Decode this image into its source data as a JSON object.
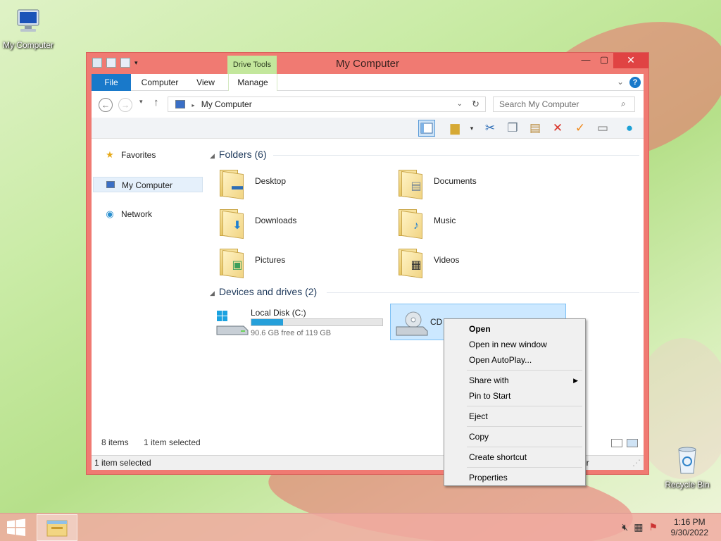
{
  "desktop": {
    "icons": [
      {
        "label": "My Computer",
        "icon": "computer-icon"
      },
      {
        "label": "Recycle Bin",
        "icon": "recycle-bin-icon"
      }
    ]
  },
  "window": {
    "title": "My Computer",
    "context_tab_group": "Drive Tools",
    "ribbon_tabs": [
      "File",
      "Computer",
      "View",
      "Manage"
    ],
    "address": "My Computer",
    "search_placeholder": "Search My Computer",
    "nav": [
      "Favorites",
      "My Computer",
      "Network"
    ],
    "folders_group": "Folders (6)",
    "folders": [
      {
        "name": "Desktop",
        "emblem": "desktop-icon"
      },
      {
        "name": "Documents",
        "emblem": "document-icon"
      },
      {
        "name": "Downloads",
        "emblem": "download-arrow-icon"
      },
      {
        "name": "Music",
        "emblem": "music-note-icon"
      },
      {
        "name": "Pictures",
        "emblem": "picture-icon"
      },
      {
        "name": "Videos",
        "emblem": "film-icon"
      }
    ],
    "devices_group": "Devices and drives (2)",
    "drives": [
      {
        "name": "Local Disk (C:)",
        "free": "90.6 GB free of 119 GB",
        "used_fraction": 0.24
      },
      {
        "name": "CD Drive (D:)"
      }
    ],
    "item_count": "8 items",
    "selection": "1 item selected",
    "status": "1 item selected",
    "status_tail": "er"
  },
  "context_menu": {
    "items": [
      {
        "label": "Open",
        "bold": true
      },
      {
        "label": "Open in new window"
      },
      {
        "label": "Open AutoPlay..."
      },
      {
        "sep": true
      },
      {
        "label": "Share with",
        "submenu": true
      },
      {
        "label": "Pin to Start"
      },
      {
        "sep": true
      },
      {
        "label": "Eject"
      },
      {
        "sep": true
      },
      {
        "label": "Copy"
      },
      {
        "sep": true
      },
      {
        "label": "Create shortcut"
      },
      {
        "sep": true
      },
      {
        "label": "Properties"
      }
    ]
  },
  "taskbar": {
    "time": "1:16 PM",
    "date": "9/30/2022"
  },
  "colors": {
    "window_frame": "#f07a72",
    "accent": "#1979ca",
    "drive_tools": "#c3e79c",
    "selection": "#cce8ff"
  }
}
